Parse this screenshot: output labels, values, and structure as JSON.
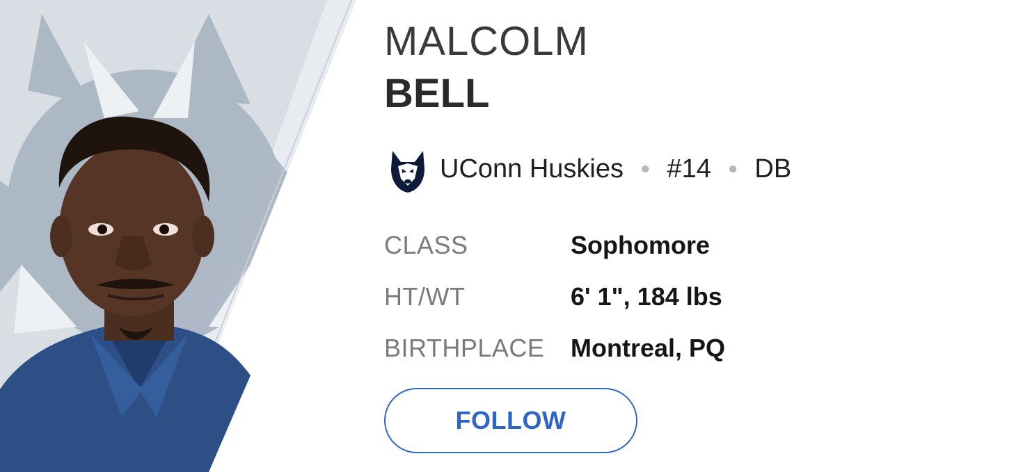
{
  "player": {
    "first_name": "MALCOLM",
    "last_name": "BELL",
    "team": "UConn Huskies",
    "number": "#14",
    "position": "DB",
    "team_logo_icon": "husky-logo-icon"
  },
  "details": [
    {
      "label": "CLASS",
      "value": "Sophomore"
    },
    {
      "label": "HT/WT",
      "value": "6' 1\", 184 lbs"
    },
    {
      "label": "BIRTHPLACE",
      "value": "Montreal, PQ"
    }
  ],
  "actions": {
    "follow_label": "FOLLOW"
  },
  "colors": {
    "accent": "#2f66c6",
    "hero_bg": "#a9b4c2",
    "jersey": "#2d4f86"
  }
}
